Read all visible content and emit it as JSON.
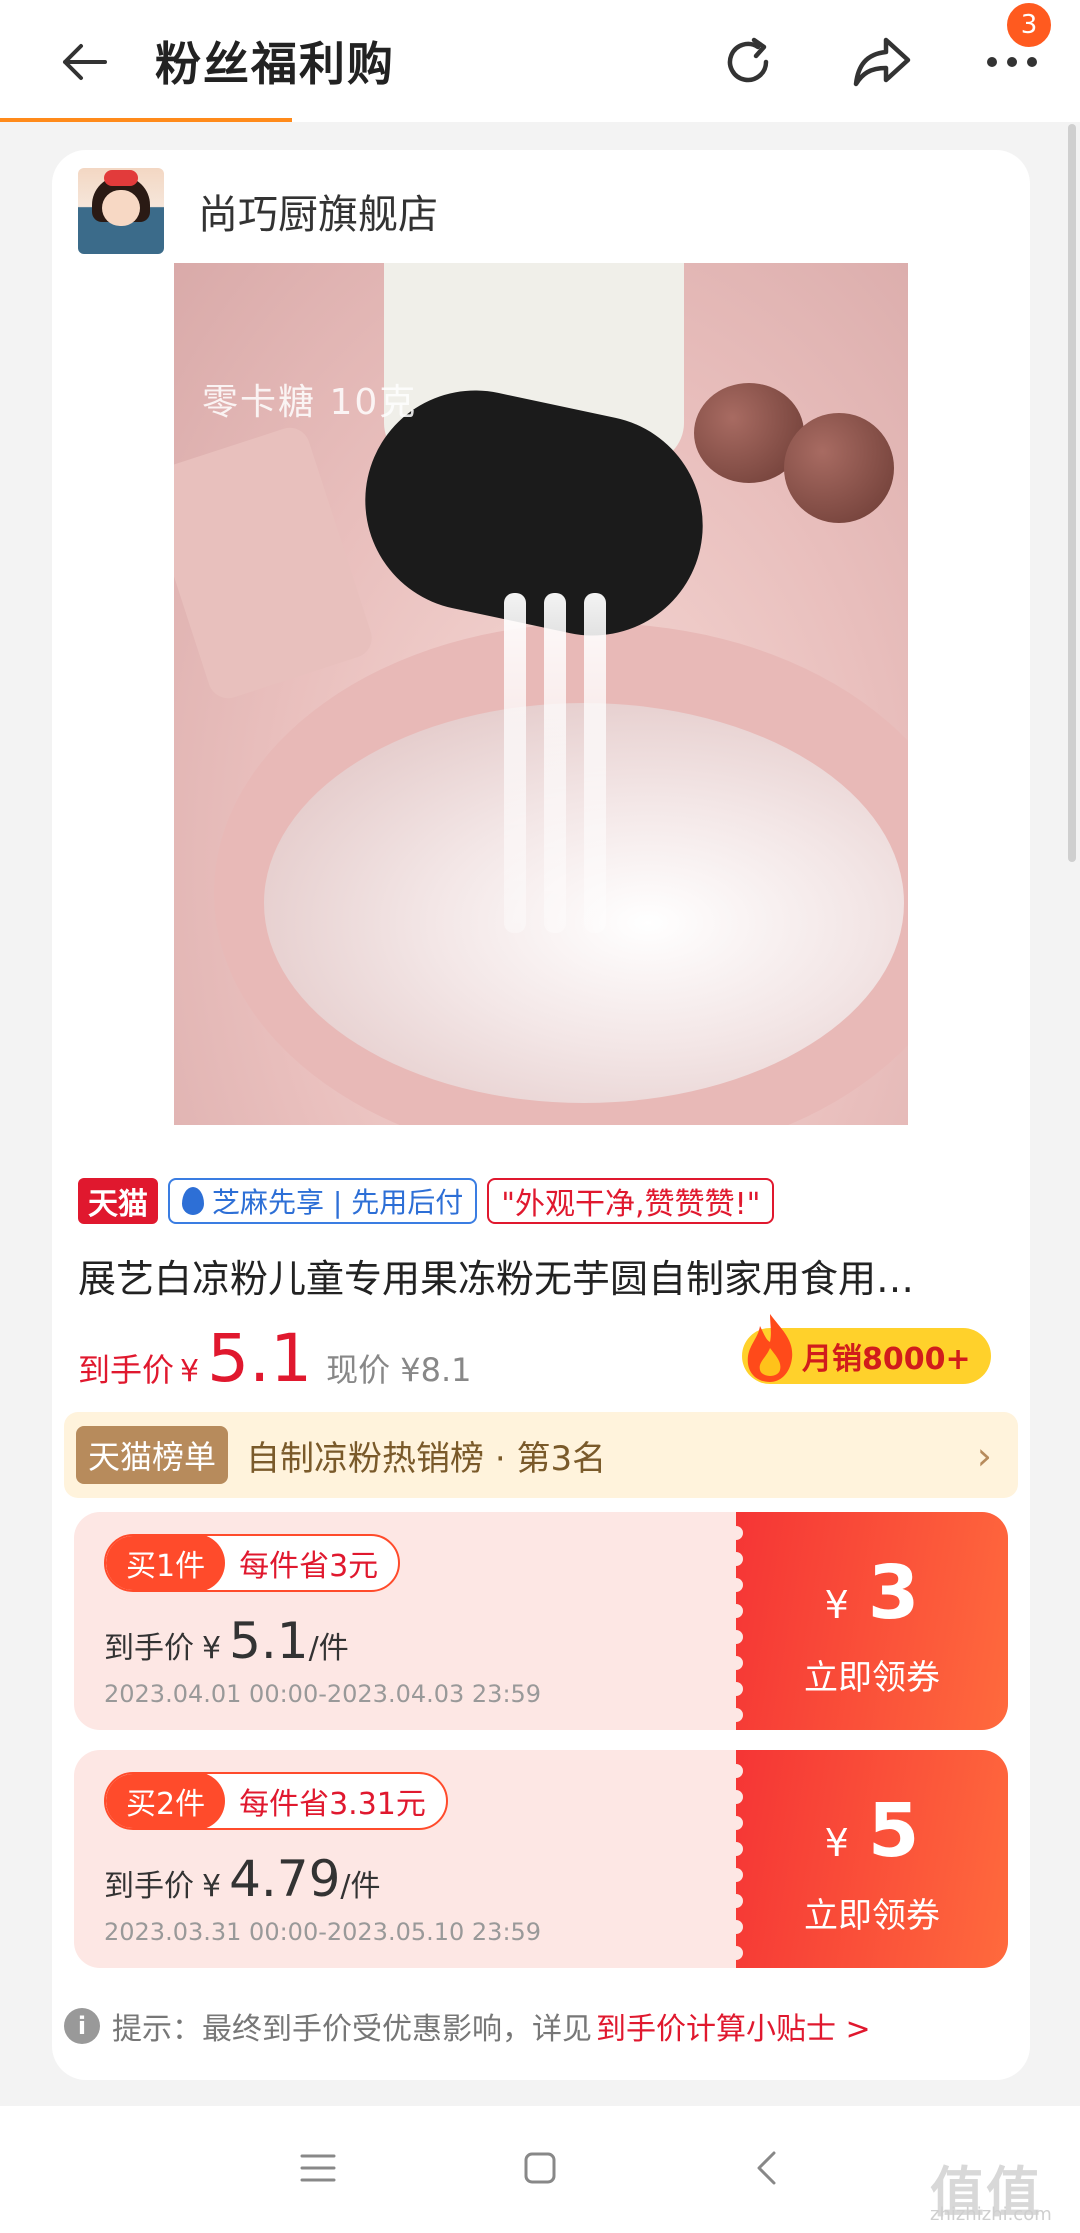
{
  "header": {
    "title": "粉丝福利购",
    "badge_count": "3"
  },
  "store": {
    "name": "尚巧厨旗舰店"
  },
  "product_image": {
    "overlay_text": "零卡糖 10克"
  },
  "tags": {
    "tmall": "天猫",
    "zhima": "芝麻先享 | 先用后付",
    "review": "\"外观干净,赞赞赞!\""
  },
  "product": {
    "title": "展艺白凉粉儿童专用果冻粉无芋圆自制家用食用…",
    "final_price_label": "到手价",
    "currency": "¥",
    "final_price": "5.1",
    "current_price": "现价 ¥8.1",
    "monthly_sales": "月销8000+"
  },
  "rank": {
    "badge": "天猫榜单",
    "text": "自制凉粉热销榜 · 第3名"
  },
  "coupons": [
    {
      "buy": "买1件",
      "save": "每件省3元",
      "price_label": "到手价",
      "currency": "¥",
      "price": "5.1",
      "unit": "/件",
      "date": "2023.04.01 00:00-2023.04.03 23:59",
      "amount_currency": "¥",
      "amount": "3",
      "action": "立即领券"
    },
    {
      "buy": "买2件",
      "save": "每件省3.31元",
      "price_label": "到手价",
      "currency": "¥",
      "price": "4.79",
      "unit": "/件",
      "date": "2023.03.31 00:00-2023.05.10 23:59",
      "amount_currency": "¥",
      "amount": "5",
      "action": "立即领券"
    }
  ],
  "tip": {
    "text": "提示：最终到手价受优惠影响，详见",
    "link": "到手价计算小贴士 >"
  },
  "watermark": {
    "text": "值值值",
    "sub": "zhizhizhi.com"
  },
  "colors": {
    "accent": "#ff8a1a",
    "brand_red": "#e0182e",
    "coupon_red": "#f53535"
  }
}
